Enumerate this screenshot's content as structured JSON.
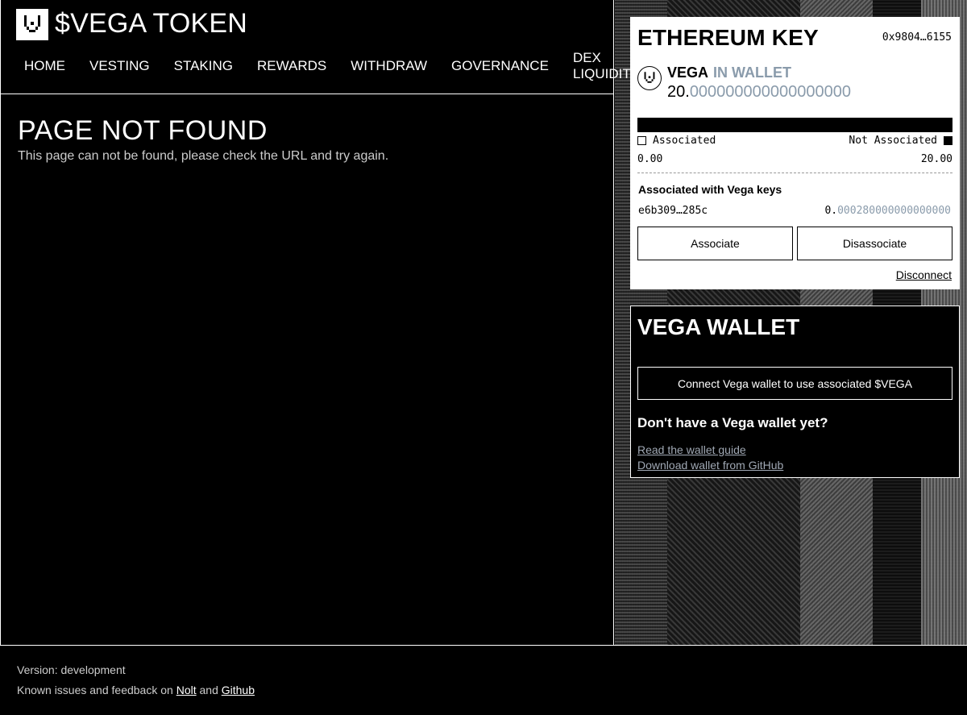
{
  "header": {
    "title": "$VEGA TOKEN",
    "logo_icon": "vega-logo-icon",
    "nav": [
      {
        "label": "HOME"
      },
      {
        "label": "VESTING"
      },
      {
        "label": "STAKING"
      },
      {
        "label": "REWARDS"
      },
      {
        "label": "WITHDRAW"
      },
      {
        "label": "GOVERNANCE"
      },
      {
        "label": "DEX LIQUIDITY"
      }
    ]
  },
  "main": {
    "title": "PAGE NOT FOUND",
    "description": "This page can not be found, please check the URL and try again."
  },
  "ethereum_card": {
    "title": "ETHEREUM KEY",
    "address": "0x9804…6155",
    "token_name": "VEGA",
    "token_status": "IN WALLET",
    "amount_int": "20.",
    "amount_dec": "000000000000000000",
    "associated_label": "Associated",
    "not_associated_label": "Not Associated",
    "associated_value": "0.00",
    "not_associated_value": "20.00",
    "associated_fraction": 0,
    "assoc_keys_title": "Associated with Vega keys",
    "vega_key": "e6b309…285c",
    "vega_key_amount_int": "0.",
    "vega_key_amount_dec": "000280000000000000",
    "associate_button": "Associate",
    "disassociate_button": "Disassociate",
    "disconnect_link": "Disconnect"
  },
  "vega_wallet_card": {
    "title": "VEGA WALLET",
    "connect_button": "Connect Vega wallet to use associated $VEGA",
    "no_wallet_text": "Don't have a Vega wallet yet?",
    "guide_link": "Read the wallet guide",
    "download_link": "Download wallet from GitHub"
  },
  "footer": {
    "version": "Version: development",
    "feedback_prefix": "Known issues and feedback on",
    "nolt_link": "Nolt",
    "and_text": "and",
    "github_link": "Github"
  },
  "colors": {
    "background": "#000000",
    "foreground": "#ffffff",
    "muted": "#8a9bab"
  }
}
